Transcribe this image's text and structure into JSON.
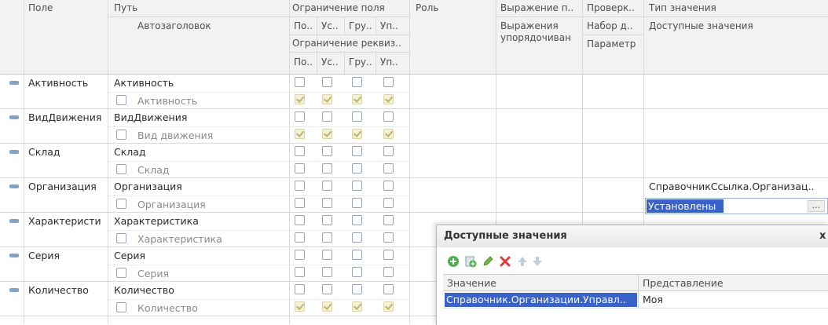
{
  "header": {
    "field": "Поле",
    "path": "Путь",
    "auto_title": "Автозаголовок",
    "field_restriction": "Ограничение поля",
    "fr_sub": [
      "По..",
      "Ус..",
      "Гру..",
      "Уп.."
    ],
    "attr_restriction": "Ограничение реквиз..",
    "ar_sub": [
      "По..",
      "Ус..",
      "Гру..",
      "Уп.."
    ],
    "role": "Роль",
    "expression": "Выражение п..",
    "expr_order_line1": "Выражения",
    "expr_order_line2": "упорядочиван",
    "check": "Проверк..",
    "data_set": "Набор д..",
    "parameter": "Параметр",
    "value_type": "Тип значения",
    "available_values": "Доступные значения"
  },
  "rows": [
    {
      "field": "Активность",
      "path": "Активность",
      "title": "Активность",
      "fr": [
        false,
        false,
        false,
        false
      ],
      "ar": [
        true,
        true,
        true,
        true
      ]
    },
    {
      "field": "ВидДвижения",
      "path": "ВидДвижения",
      "title": "Вид движения",
      "fr": [
        false,
        false,
        false,
        false
      ],
      "ar": [
        true,
        true,
        true,
        true
      ]
    },
    {
      "field": "Склад",
      "path": "Склад",
      "title": "Склад",
      "fr": [
        false,
        false,
        false,
        false
      ],
      "ar": [
        false,
        false,
        false,
        false
      ]
    },
    {
      "field": "Организация",
      "path": "Организация",
      "title": "Организация",
      "fr": [
        false,
        false,
        false,
        false
      ],
      "ar": [
        false,
        false,
        false,
        false
      ],
      "value_type": "СправочникСсылка.Организац..",
      "available_values": "Установлены"
    },
    {
      "field": "Характеристи",
      "path": "Характеристика",
      "title": "Характеристика",
      "fr": [
        false,
        false,
        false,
        false
      ],
      "ar": [
        false,
        false,
        false,
        false
      ]
    },
    {
      "field": "Серия",
      "path": "Серия",
      "title": "Серия",
      "fr": [
        false,
        false,
        false,
        false
      ],
      "ar": [
        false,
        false,
        false,
        false
      ]
    },
    {
      "field": "Количество",
      "path": "Количество",
      "title": "Количество",
      "fr": [
        false,
        false,
        false,
        false
      ],
      "ar": [
        true,
        true,
        true,
        true
      ]
    }
  ],
  "ellipsis": "...",
  "dialog": {
    "title": "Доступные значения",
    "close": "x",
    "toolbar": [
      "add-icon",
      "add-group-icon",
      "edit-icon",
      "delete-icon",
      "move-up-icon",
      "move-down-icon"
    ],
    "col_value": "Значение",
    "col_repr": "Представление",
    "row_value": "Справочник.Организации.Управл..",
    "row_repr": "Моя"
  },
  "colors": {
    "selection": "#3a62c9",
    "header_bg": "#f2f2f2",
    "checked_bg": "#f4f1d9"
  }
}
